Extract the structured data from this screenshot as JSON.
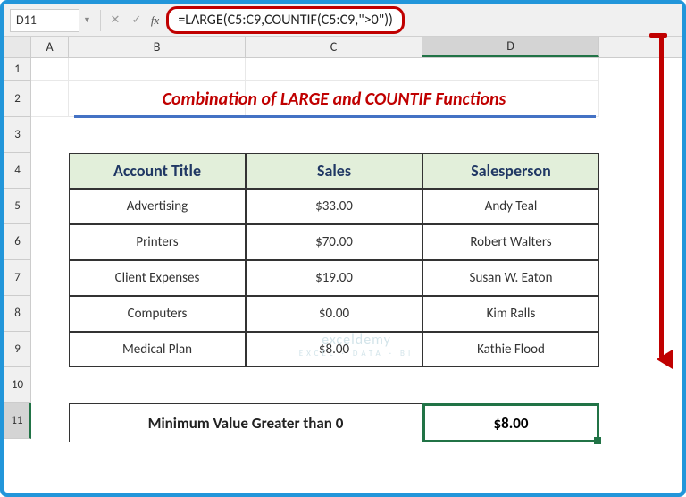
{
  "cellRef": "D11",
  "formula": "=LARGE(C5:C9,COUNTIF(C5:C9,\">0\"))",
  "title": "Combination of LARGE and COUNTIF Functions",
  "columns": {
    "A": "A",
    "B": "B",
    "C": "C",
    "D": "D"
  },
  "rows": [
    "1",
    "2",
    "3",
    "4",
    "5",
    "6",
    "7",
    "8",
    "9",
    "10",
    "11"
  ],
  "headers": {
    "b": "Account Title",
    "c": "Sales",
    "d": "Salesperson"
  },
  "data": [
    {
      "b": "Advertising",
      "c": "$33.00",
      "d": "Andy Teal"
    },
    {
      "b": "Printers",
      "c": "$70.00",
      "d": "Robert Walters"
    },
    {
      "b": "Client Expenses",
      "c": "$19.00",
      "d": "Susan W. Eaton"
    },
    {
      "b": "Computers",
      "c": "$0.00",
      "d": "Kim Ralls"
    },
    {
      "b": "Medical Plan",
      "c": "$8.00",
      "d": "Kathie Flood"
    }
  ],
  "resultLabel": "Minimum Value Greater than 0",
  "resultValue": "$8.00",
  "watermark": {
    "main": "exceldemy",
    "sub": "EXCEL · DATA · BI"
  },
  "chart_data": {
    "type": "table",
    "title": "Combination of LARGE and COUNTIF Functions",
    "formula": "=LARGE(C5:C9,COUNTIF(C5:C9,\">0\"))",
    "columns": [
      "Account Title",
      "Sales",
      "Salesperson"
    ],
    "rows": [
      [
        "Advertising",
        33.0,
        "Andy Teal"
      ],
      [
        "Printers",
        70.0,
        "Robert Walters"
      ],
      [
        "Client Expenses",
        19.0,
        "Susan W. Eaton"
      ],
      [
        "Computers",
        0.0,
        "Kim Ralls"
      ],
      [
        "Medical Plan",
        8.0,
        "Kathie Flood"
      ]
    ],
    "computed": {
      "label": "Minimum Value Greater than 0",
      "value": 8.0
    }
  }
}
